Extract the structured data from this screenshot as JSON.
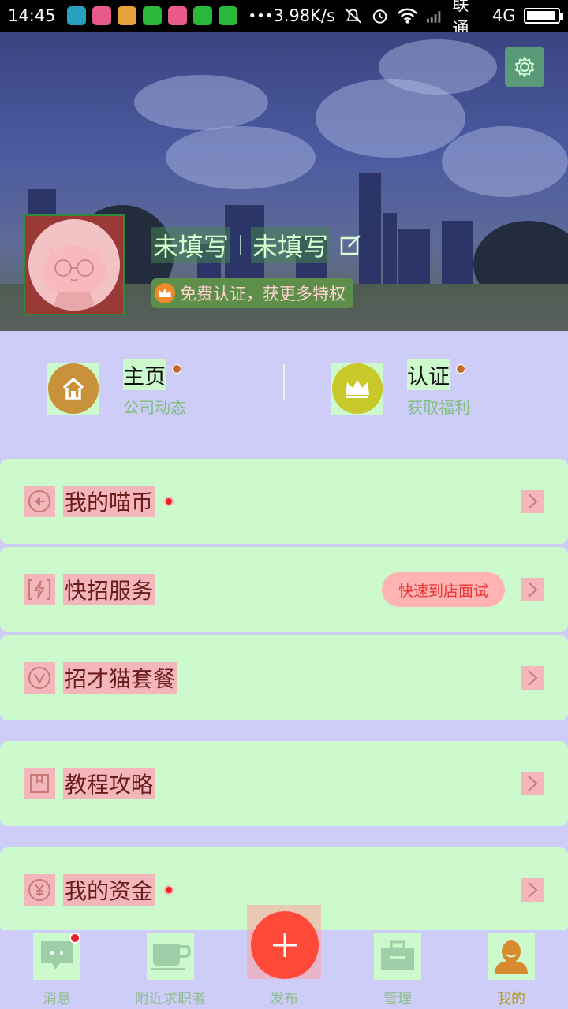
{
  "status_bar": {
    "time": "14:45",
    "net_speed": "3.98K/s",
    "carrier": "联通",
    "network": "4G",
    "more": "•••",
    "battery_level": 0.95
  },
  "header": {
    "company_name": "未填写",
    "position_name": "未填写",
    "cert_badge_text": "免费认证，获更多特权"
  },
  "quick": [
    {
      "title": "主页",
      "subtitle": "公司动态",
      "color": "#c9923a"
    },
    {
      "title": "认证",
      "subtitle": "获取福利",
      "color": "#c8c82a"
    }
  ],
  "menu": [
    {
      "label": "我的喵币",
      "has_dot": true
    },
    {
      "label": "快招服务",
      "tag": "快速到店面试"
    },
    {
      "label": "招才猫套餐"
    },
    {
      "label": "教程攻略"
    },
    {
      "label": "我的资金",
      "has_dot": true
    }
  ],
  "tabs": [
    {
      "label": "消息"
    },
    {
      "label": "附近求职者"
    },
    {
      "label": "发布"
    },
    {
      "label": "管理"
    },
    {
      "label": "我的"
    }
  ],
  "colors": {
    "accent_red": "#ff4a3a",
    "card_green": "#cdfacd",
    "highlight_pink": "#f3b6ba",
    "active_tab": "#b59a18"
  }
}
